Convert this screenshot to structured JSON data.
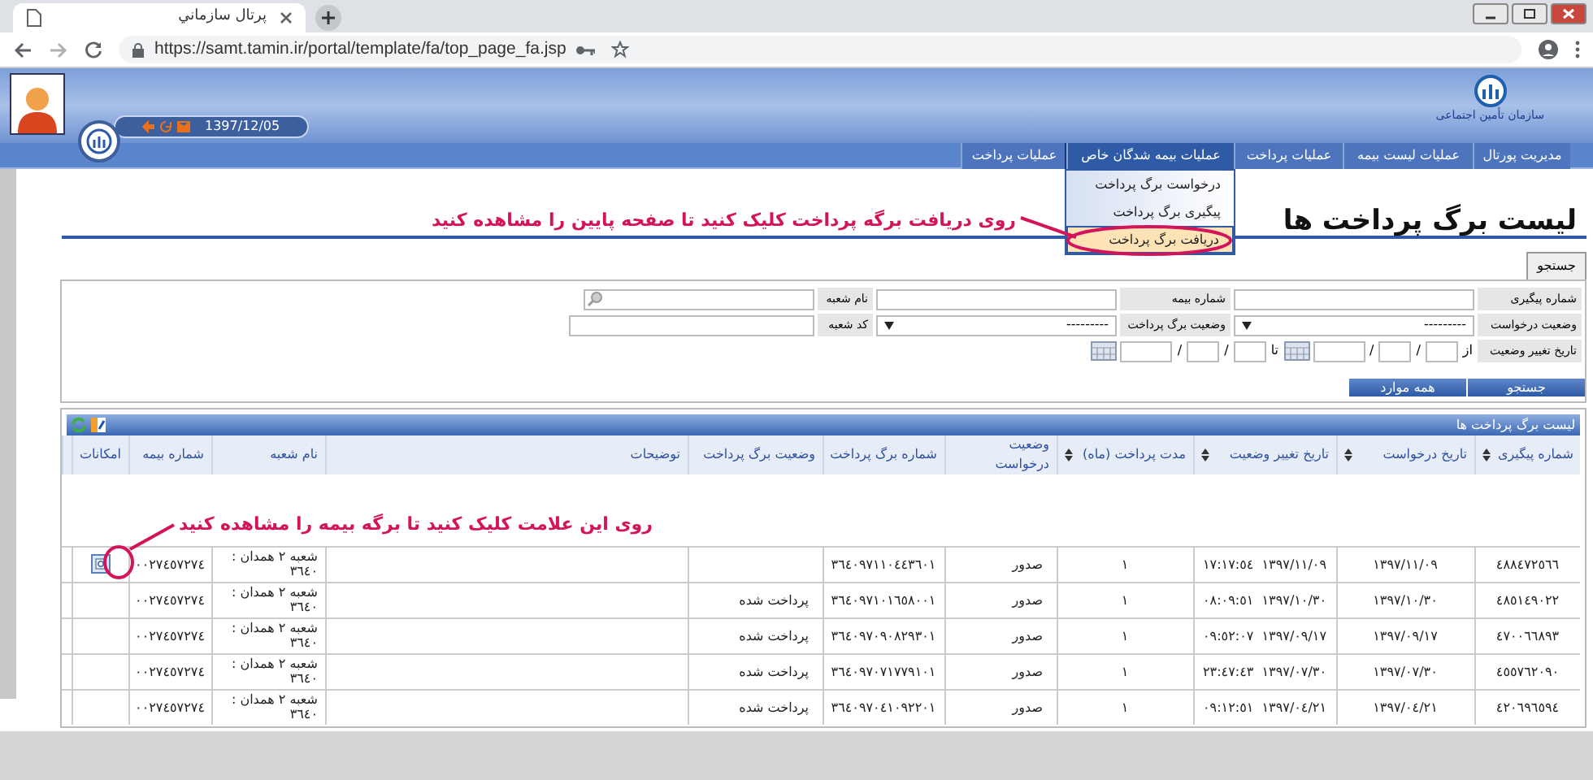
{
  "browser": {
    "tab_title": "پرتال سازماني",
    "url": "https://samt.tamin.ir/portal/template/fa/top_page_fa.jsp"
  },
  "header": {
    "date": "1397/12/05",
    "logo_text": "سازمان تأمین اجتماعی"
  },
  "menu": [
    {
      "label": "مدیریت پورتال",
      "selected": false
    },
    {
      "label": "عملیات لیست بیمه",
      "selected": false
    },
    {
      "label": "عملیات پرداخت",
      "selected": false
    },
    {
      "label": "عملیات بیمه شدگان خاص",
      "selected": true
    },
    {
      "label": "عملیات پرداخت",
      "selected": false
    }
  ],
  "dropdown": [
    {
      "label": "درخواست برگ پرداخت",
      "selected": false
    },
    {
      "label": "پیگیری برگ پرداخت",
      "selected": false
    },
    {
      "label": "دریافت برگ پرداخت",
      "selected": true
    }
  ],
  "page_title": "لیست برگ پرداخت ها",
  "annotations": [
    {
      "text": "روی دریافت برگه پرداخت کلیک کنید تا صفحه پایین را مشاهده کنید"
    },
    {
      "text": "روی این علامت کلیک کنید تا برگه بیمه را مشاهده کنید"
    }
  ],
  "search": {
    "tab_label": "جستجو",
    "labels": {
      "tracking": "شماره پیگیری",
      "insurance": "شماره بیمه",
      "branch_name": "نام شعبه",
      "request_status": "وضعیت درخواست",
      "slip_status": "وضعیت برگ پرداخت",
      "branch_code": "کد شعبه",
      "change_date": "تاریخ تغییر وضعیت",
      "from": "از",
      "to": "تا"
    },
    "request_status_value": "---------",
    "slip_status_value": "---------",
    "date_separator": "/",
    "buttons": [
      "جستجو",
      "همه موارد"
    ]
  },
  "grid": {
    "title": "لیست برگ پرداخت ها",
    "columns": [
      {
        "label": "شماره پیگیری",
        "sortable": true
      },
      {
        "label": "تاریخ درخواست",
        "sortable": true
      },
      {
        "label": "تاریخ تغییر وضعیت",
        "sortable": true
      },
      {
        "label": "مدت پرداخت (ماه)",
        "sortable": true
      },
      {
        "label": "وضعیت درخواست",
        "sortable": false
      },
      {
        "label": "شماره برگ پرداخت",
        "sortable": false
      },
      {
        "label": "وضعیت برگ پرداخت",
        "sortable": false
      },
      {
        "label": "توضیحات",
        "sortable": false
      },
      {
        "label": "نام شعبه",
        "sortable": false
      },
      {
        "label": "شماره بیمه",
        "sortable": false
      },
      {
        "label": "امکانات",
        "sortable": false
      }
    ],
    "rows": [
      {
        "tracking": "٤٨٨٤٧٢٥٦٦",
        "request_date": "١٣٩٧/١١/٠٩",
        "change_date": "١٣٩٧/١١/٠٩  ١٧:١٧:٥٤",
        "months": "١",
        "request_status": "صدور",
        "slip_number": "٣٦٤٠٩٧١١٠٤٤٣٦٠١",
        "branch": "شعبه ٢ همدان : ٣٦٤٠",
        "insurance_number": "٠٠٢٧٤٥٧٢٧٤",
        "view_icon": true
      },
      {
        "tracking": "٤٨٥١٤٩٠٢٢",
        "request_date": "١٣٩٧/١٠/٣٠",
        "change_date": "١٣٩٧/١٠/٣٠  ٠٨:٠٩:٥١",
        "months": "١",
        "request_status": "صدور",
        "slip_number": "٣٦٤٠٩٧١٠١٦٥٨٠٠١",
        "slip_status": "پرداخت شده",
        "branch": "شعبه ٢ همدان : ٣٦٤٠",
        "insurance_number": "٠٠٢٧٤٥٧٢٧٤",
        "view_icon": false
      },
      {
        "tracking": "٤٧٠٠٦٦٨٩٣",
        "request_date": "١٣٩٧/٠٩/١٧",
        "change_date": "١٣٩٧/٠٩/١٧  ٠٩:٥٢:٠٧",
        "months": "١",
        "request_status": "صدور",
        "slip_number": "٣٦٤٠٩٧٠٩٠٨٢٩٣٠١",
        "slip_status": "پرداخت شده",
        "branch": "شعبه ٢ همدان : ٣٦٤٠",
        "insurance_number": "٠٠٢٧٤٥٧٢٧٤",
        "view_icon": false
      },
      {
        "tracking": "٤٥٥٧٦٢٠٩٠",
        "request_date": "١٣٩٧/٠٧/٣٠",
        "change_date": "١٣٩٧/٠٧/٣٠  ٢٣:٤٧:٤٣",
        "months": "١",
        "request_status": "صدور",
        "slip_number": "٣٦٤٠٩٧٠٧١٧٧٩١٠١",
        "slip_status": "پرداخت شده",
        "branch": "شعبه ٢ همدان : ٣٦٤٠",
        "insurance_number": "٠٠٢٧٤٥٧٢٧٤",
        "view_icon": false
      },
      {
        "tracking": "٤٢٠٦٩٦٥٩٤",
        "request_date": "١٣٩٧/٠٤/٢١",
        "change_date": "١٣٩٧/٠٤/٢١  ٠٩:١٢:٥١",
        "months": "١",
        "request_status": "صدور",
        "slip_number": "٣٦٤٠٩٧٠٤١٠٩٢٢٠١",
        "slip_status": "پرداخت شده",
        "branch": "شعبه ٢ همدان : ٣٦٤٠",
        "insurance_number": "٠٠٢٧٤٥٧٢٧٤",
        "view_icon": false
      }
    ]
  }
}
